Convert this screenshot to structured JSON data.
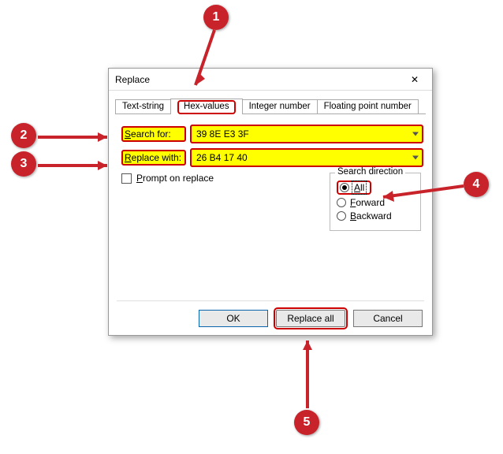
{
  "dialog": {
    "title": "Replace",
    "tabs": [
      "Text-string",
      "Hex-values",
      "Integer number",
      "Floating point number"
    ],
    "active_tab_index": 1,
    "search_label_pre": "S",
    "search_label_post": "earch for:",
    "replace_label_pre": "R",
    "replace_label_post": "eplace with:",
    "search_value": "39 8E E3 3F",
    "replace_value": "26 B4 17 40",
    "prompt_pre": "P",
    "prompt_post": "rompt on replace",
    "direction": {
      "title": "Search direction",
      "all_pre": "A",
      "all_post": "ll",
      "fwd_pre": "F",
      "fwd_post": "orward",
      "bwd_pre": "B",
      "bwd_post": "ackward",
      "selected": "all"
    },
    "buttons": {
      "ok": "OK",
      "replace_all": "Replace all",
      "cancel": "Cancel"
    }
  },
  "annotations": {
    "b1": "1",
    "b2": "2",
    "b3": "3",
    "b4": "4",
    "b5": "5"
  }
}
